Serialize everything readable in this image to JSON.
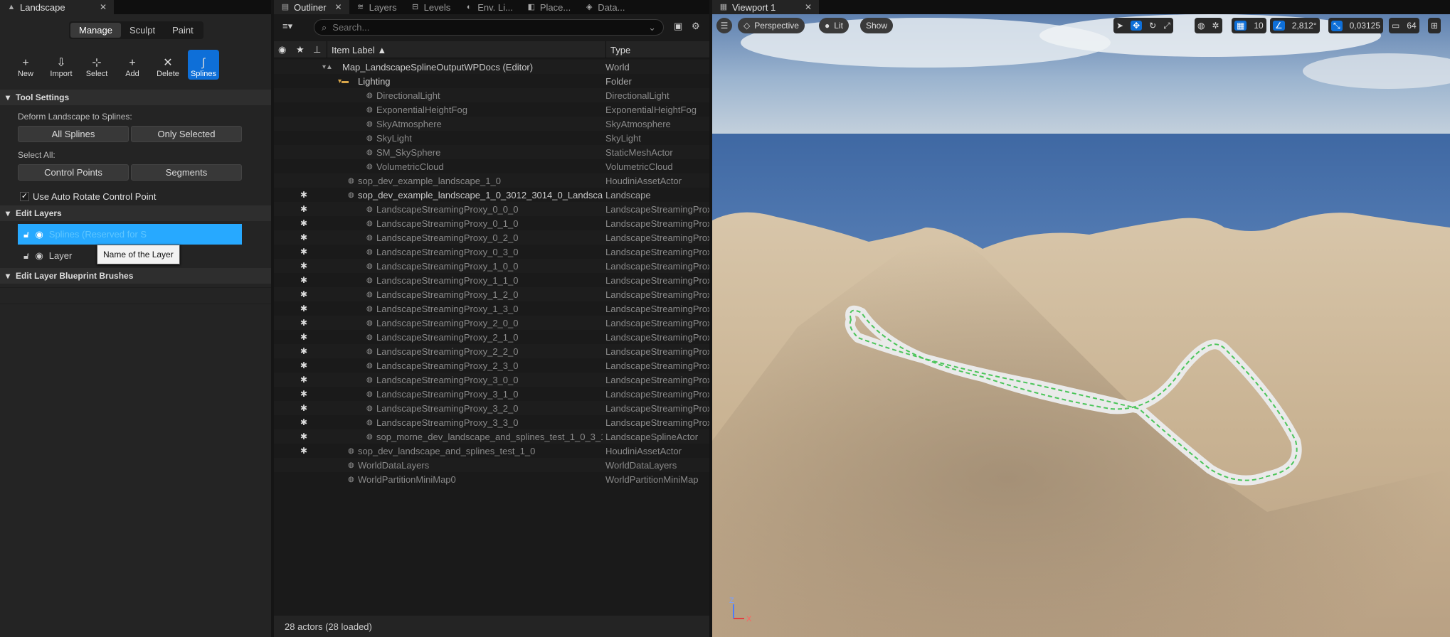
{
  "left_panel": {
    "tab": "Landscape",
    "modes": [
      "Manage",
      "Sculpt",
      "Paint"
    ],
    "tools": [
      {
        "label": "New",
        "icon": "+"
      },
      {
        "label": "Import",
        "icon": "⇩"
      },
      {
        "label": "Select",
        "icon": "⊹"
      },
      {
        "label": "Add",
        "icon": "+"
      },
      {
        "label": "Delete",
        "icon": "✕"
      },
      {
        "label": "Splines",
        "icon": "∫"
      }
    ],
    "tool_settings": "Tool Settings",
    "deform_label": "Deform Landscape to Splines:",
    "all_splines": "All Splines",
    "only_selected": "Only Selected",
    "select_all": "Select All:",
    "control_points": "Control Points",
    "segments": "Segments",
    "auto_rotate": "Use Auto Rotate Control Point",
    "edit_layers": "Edit Layers",
    "layer1": "Splines (Reserved for S",
    "layer2": "Layer",
    "tooltip": "Name of the Layer",
    "blueprint_brushes": "Edit Layer Blueprint Brushes"
  },
  "outliner": {
    "tabs": [
      "Outliner",
      "Layers",
      "Levels",
      "Env. Li...",
      "Place...",
      "Data..."
    ],
    "search_placeholder": "Search...",
    "col_label": "Item Label ▲",
    "col_type": "Type",
    "rows": [
      {
        "label": "Map_LandscapeSplineOutputWPDocs (Editor)",
        "type": "World",
        "indent": 0,
        "star": "",
        "dim": false
      },
      {
        "label": "Lighting",
        "type": "Folder",
        "indent": 1,
        "star": "",
        "dim": false
      },
      {
        "label": "DirectionalLight",
        "type": "DirectionalLight",
        "indent": 2,
        "star": "",
        "dim": true
      },
      {
        "label": "ExponentialHeightFog",
        "type": "ExponentialHeightFog",
        "indent": 2,
        "star": "",
        "dim": true
      },
      {
        "label": "SkyAtmosphere",
        "type": "SkyAtmosphere",
        "indent": 2,
        "star": "",
        "dim": true
      },
      {
        "label": "SkyLight",
        "type": "SkyLight",
        "indent": 2,
        "star": "",
        "dim": true
      },
      {
        "label": "SM_SkySphere",
        "type": "StaticMeshActor",
        "indent": 2,
        "star": "",
        "dim": true
      },
      {
        "label": "VolumetricCloud",
        "type": "VolumetricCloud",
        "indent": 2,
        "star": "",
        "dim": true
      },
      {
        "label": "sop_dev_example_landscape_1_0",
        "type": "HoudiniAssetActor",
        "indent": 1,
        "star": "",
        "dim": true
      },
      {
        "label": "sop_dev_example_landscape_1_0_3012_3014_0_Landsca",
        "type": "Landscape",
        "indent": 1,
        "star": "✱",
        "dim": false
      },
      {
        "label": "LandscapeStreamingProxy_0_0_0",
        "type": "LandscapeStreamingProx",
        "indent": 2,
        "star": "✱",
        "dim": true
      },
      {
        "label": "LandscapeStreamingProxy_0_1_0",
        "type": "LandscapeStreamingProx",
        "indent": 2,
        "star": "✱",
        "dim": true
      },
      {
        "label": "LandscapeStreamingProxy_0_2_0",
        "type": "LandscapeStreamingProx",
        "indent": 2,
        "star": "✱",
        "dim": true
      },
      {
        "label": "LandscapeStreamingProxy_0_3_0",
        "type": "LandscapeStreamingProx",
        "indent": 2,
        "star": "✱",
        "dim": true
      },
      {
        "label": "LandscapeStreamingProxy_1_0_0",
        "type": "LandscapeStreamingProx",
        "indent": 2,
        "star": "✱",
        "dim": true
      },
      {
        "label": "LandscapeStreamingProxy_1_1_0",
        "type": "LandscapeStreamingProx",
        "indent": 2,
        "star": "✱",
        "dim": true
      },
      {
        "label": "LandscapeStreamingProxy_1_2_0",
        "type": "LandscapeStreamingProx",
        "indent": 2,
        "star": "✱",
        "dim": true
      },
      {
        "label": "LandscapeStreamingProxy_1_3_0",
        "type": "LandscapeStreamingProx",
        "indent": 2,
        "star": "✱",
        "dim": true
      },
      {
        "label": "LandscapeStreamingProxy_2_0_0",
        "type": "LandscapeStreamingProx",
        "indent": 2,
        "star": "✱",
        "dim": true
      },
      {
        "label": "LandscapeStreamingProxy_2_1_0",
        "type": "LandscapeStreamingProx",
        "indent": 2,
        "star": "✱",
        "dim": true
      },
      {
        "label": "LandscapeStreamingProxy_2_2_0",
        "type": "LandscapeStreamingProx",
        "indent": 2,
        "star": "✱",
        "dim": true
      },
      {
        "label": "LandscapeStreamingProxy_2_3_0",
        "type": "LandscapeStreamingProx",
        "indent": 2,
        "star": "✱",
        "dim": true
      },
      {
        "label": "LandscapeStreamingProxy_3_0_0",
        "type": "LandscapeStreamingProx",
        "indent": 2,
        "star": "✱",
        "dim": true
      },
      {
        "label": "LandscapeStreamingProxy_3_1_0",
        "type": "LandscapeStreamingProx",
        "indent": 2,
        "star": "✱",
        "dim": true
      },
      {
        "label": "LandscapeStreamingProxy_3_2_0",
        "type": "LandscapeStreamingProx",
        "indent": 2,
        "star": "✱",
        "dim": true
      },
      {
        "label": "LandscapeStreamingProxy_3_3_0",
        "type": "LandscapeStreamingProx",
        "indent": 2,
        "star": "✱",
        "dim": true
      },
      {
        "label": "sop_morne_dev_landscape_and_splines_test_1_0_3_14",
        "type": "LandscapeSplineActor",
        "indent": 2,
        "star": "✱",
        "dim": true
      },
      {
        "label": "sop_dev_landscape_and_splines_test_1_0",
        "type": "HoudiniAssetActor",
        "indent": 1,
        "star": "✱",
        "dim": true
      },
      {
        "label": "WorldDataLayers",
        "type": "WorldDataLayers",
        "indent": 1,
        "star": "",
        "dim": true
      },
      {
        "label": "WorldPartitionMiniMap0",
        "type": "WorldPartitionMiniMap",
        "indent": 1,
        "star": "",
        "dim": true
      }
    ],
    "status": "28 actors (28 loaded)"
  },
  "viewport": {
    "tab": "Viewport 1",
    "perspective": "Perspective",
    "lit": "Lit",
    "show": "Show",
    "grid": "10",
    "angle": "2,812°",
    "scale": "0,03125",
    "camera": "64"
  }
}
